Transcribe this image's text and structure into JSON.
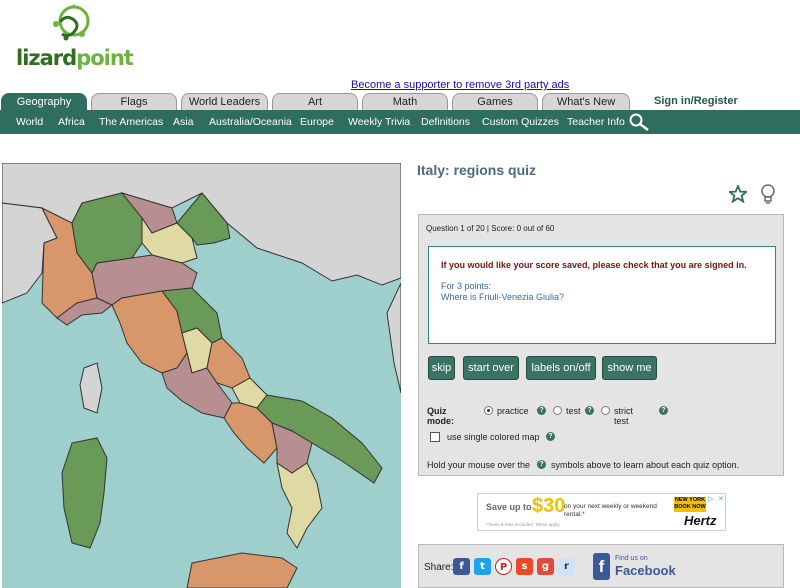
{
  "logo": {
    "part1": "lizard",
    "part2": "point"
  },
  "supporter_link": "Become a supporter to remove 3rd party ads",
  "tabs": [
    {
      "label": "Geography",
      "active": true
    },
    {
      "label": "Flags"
    },
    {
      "label": "World Leaders"
    },
    {
      "label": "Art"
    },
    {
      "label": "Math"
    },
    {
      "label": "Games"
    },
    {
      "label": "What's New"
    }
  ],
  "signin": "Sign in/Register",
  "nav": [
    "World",
    "Africa",
    "The Americas",
    "Asia",
    "Australia/Oceania",
    "Europe",
    "Weekly Trivia",
    "Definitions",
    "Custom Quizzes",
    "Teacher Info"
  ],
  "quiz": {
    "title": "Italy: regions quiz",
    "status": "Question 1 of 20 | Score: 0 out of 60",
    "signed_msg": "If you would like your score saved, please check that you are signed in.",
    "points": "For 3 points:",
    "question": "Where is Friuli-Venezia Giulia?",
    "buttons": {
      "skip": "skip",
      "start_over": "start over",
      "labels": "labels on/off",
      "show_me": "show me"
    },
    "mode_label": "Quiz mode:",
    "modes": {
      "practice": "practice",
      "test": "test",
      "strict": "strict test"
    },
    "single_map": "use single colored map",
    "hover_pre": "Hold your mouse over the",
    "hover_post": "symbols above to learn about each quiz option."
  },
  "ad": {
    "save": "Save up to",
    "amount": "$30",
    "sub": "on your next weekly or weekend rental.*",
    "fine": "*Taxes & fees excluded. Terms apply.",
    "book": "NEW YORK BOOK NOW",
    "brand": "Hertz"
  },
  "share": {
    "label": "Share:",
    "fb_small": "Find us on",
    "fb_big": "Facebook"
  },
  "colors": {
    "accent": "#2f6d5f",
    "sea": "#9fcfcd",
    "land_grey": "#d4d4d4",
    "orange": "#d8976a",
    "green": "#6a9a58",
    "mauve": "#b88f91",
    "cream": "#dfd9a3"
  }
}
